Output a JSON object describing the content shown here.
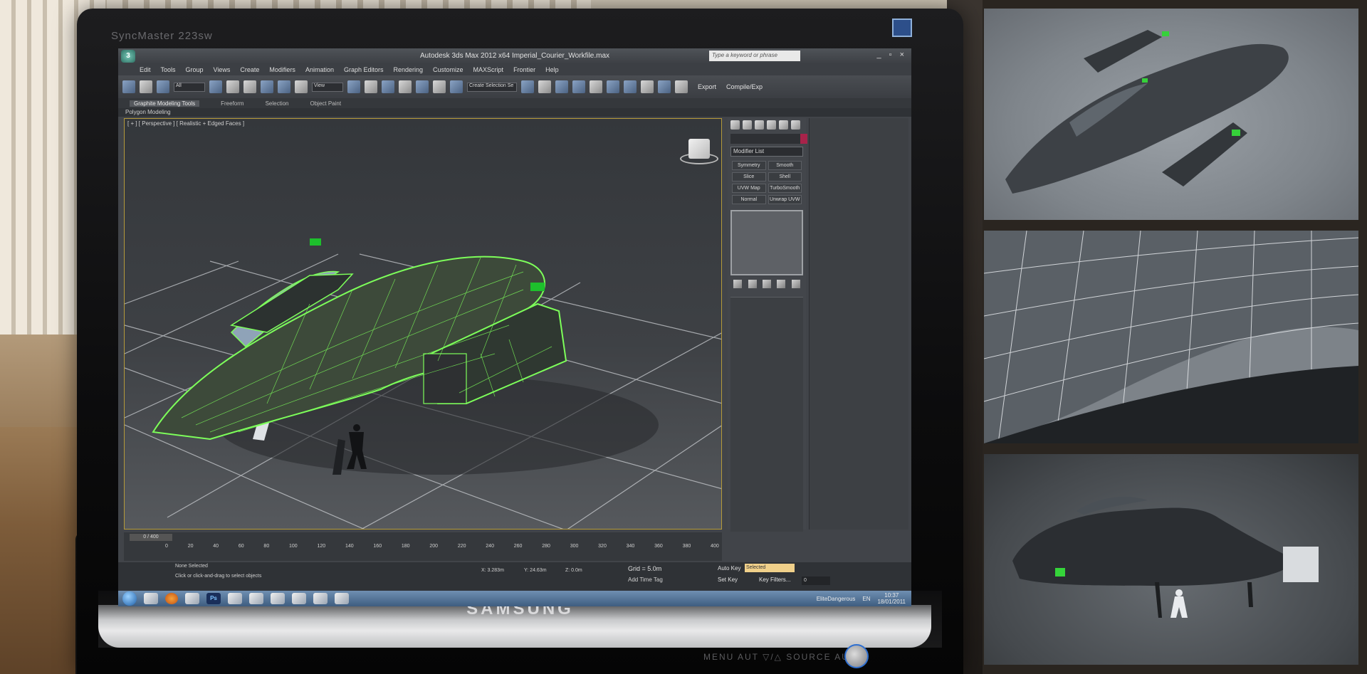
{
  "monitor": {
    "model_label": "SyncMaster 223sw",
    "brand": "SAMSUNG",
    "bottom_buttons_text": "MENU AUT ▽/△ SOURCE AUTO"
  },
  "app": {
    "logo_text": "3",
    "window_title": "Autodesk 3ds Max  2012 x64    Imperial_Courier_Workfile.max",
    "search_placeholder": "Type a keyword or phrase",
    "window_controls": "_ ▫ ×",
    "menus": [
      "Edit",
      "Tools",
      "Group",
      "Views",
      "Create",
      "Modifiers",
      "Animation",
      "Graph Editors",
      "Rendering",
      "Customize",
      "MAXScript",
      "Frontier",
      "Help"
    ],
    "toolbar": {
      "selection_filter": "All",
      "view_dropdown": "View",
      "selection_set": "Create Selection Se",
      "export_label": "Export",
      "compile_label": "Compile/Exp"
    },
    "ribbon_tabs": [
      "Graphite Modeling Tools",
      "Freeform",
      "Selection",
      "Object Paint"
    ],
    "ribbon_active": 0,
    "ribbon_sub": "Polygon Modeling",
    "viewport_label": "[ + ] [ Perspective ] [ Realistic + Edged Faces ]",
    "command_panel": {
      "modifier_list": "Modifier List",
      "modifiers": [
        "Symmetry",
        "Smooth",
        "Slice",
        "Shell",
        "UVW Map",
        "TurboSmooth",
        "Normal",
        "Unwrap UVW"
      ]
    },
    "timeline": {
      "slider_label": "0 / 400",
      "ticks": [
        "0",
        "20",
        "40",
        "60",
        "80",
        "100",
        "120",
        "140",
        "160",
        "180",
        "200",
        "220",
        "240",
        "260",
        "280",
        "300",
        "320",
        "340",
        "360",
        "380",
        "400"
      ]
    },
    "status": {
      "selection": "None Selected",
      "hint": "Click or click-and-drag to select objects",
      "x": "X: 3.283m",
      "y": "Y: 24.63m",
      "z": "Z: 0.0m",
      "grid": "Grid = 5.0m",
      "add_time_tag": "Add Time Tag",
      "auto_key": "Auto Key",
      "selected_dropdown": "Selected",
      "set_key": "Set Key",
      "key_filters": "Key Filters...",
      "frame": "0"
    },
    "taskbar": {
      "user": "EliteDangerous",
      "language": "EN",
      "time": "10:37",
      "date": "18/01/2011"
    }
  },
  "icons": [
    "start-orb-icon",
    "explorer-icon",
    "firefox-icon",
    "folder-icon",
    "photoshop-icon",
    "3dsmax-icon",
    "steam-icon",
    "font-icon",
    "quicktime-icon",
    "lync-icon",
    "remote-icon"
  ]
}
